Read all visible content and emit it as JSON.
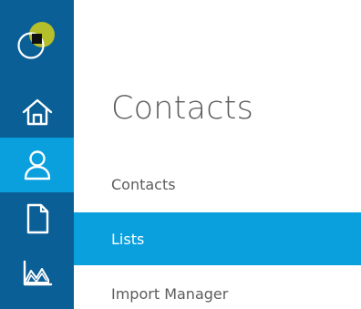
{
  "rail": {
    "logo": "logo-mark",
    "items": [
      {
        "id": "home",
        "icon": "home-icon"
      },
      {
        "id": "contacts",
        "icon": "user-icon",
        "active": true
      },
      {
        "id": "documents",
        "icon": "document-icon"
      },
      {
        "id": "reports",
        "icon": "chart-icon"
      }
    ]
  },
  "panel": {
    "title": "Contacts",
    "items": [
      {
        "label": "Contacts"
      },
      {
        "label": "Lists",
        "active": true
      },
      {
        "label": "Import Manager"
      }
    ]
  },
  "colors": {
    "rail_bg": "#0b5f97",
    "accent": "#0aa0de",
    "logo_green": "#b5be2b"
  }
}
